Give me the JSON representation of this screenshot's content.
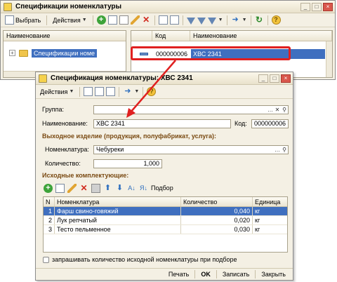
{
  "back_window": {
    "title": "Спецификации номенклатуры",
    "toolbar": {
      "select_label": "Выбрать",
      "actions_label": "Действия"
    },
    "left_pane": {
      "header": "Наименование",
      "tree_item": "Спецификации номе"
    },
    "right_pane": {
      "headers": {
        "code": "Код",
        "name": "Наименование"
      },
      "row": {
        "code": "000000006",
        "name": "ХВС 2341"
      }
    }
  },
  "front_window": {
    "title": "Спецификация номенклатуры: ХВС 2341",
    "toolbar": {
      "actions_label": "Действия"
    },
    "group_label": "Группа:",
    "group_value": "",
    "name_label": "Наименование:",
    "name_value": "ХВС 2341",
    "code_label": "Код:",
    "code_value": "000000006",
    "output_section": "Выходное изделие (продукция, полуфабрикат, услуга):",
    "nomenclature_label": "Номенклатура:",
    "nomenclature_value": "Чебуреки",
    "quantity_label": "Количество:",
    "quantity_value": "1,000",
    "components_section": "Исходные комплектующие:",
    "selection_label": "Подбор",
    "table": {
      "headers": [
        "N",
        "Номенклатура",
        "Количество",
        "Единица"
      ],
      "rows": [
        {
          "n": "1",
          "nom": "Фарш свино-говяжий",
          "qty": "0,040",
          "unit": "кг"
        },
        {
          "n": "2",
          "nom": "Лук репчатый",
          "qty": "0,020",
          "unit": "кг"
        },
        {
          "n": "3",
          "nom": "Тесто пельменное",
          "qty": "0,030",
          "unit": "кг"
        }
      ]
    },
    "checkbox_label": "запрашивать количество исходной номенклатуры при подборе",
    "footer": {
      "print": "Печать",
      "ok": "OK",
      "save": "Записать",
      "close": "Закрыть"
    }
  },
  "colors": {
    "selection": "#3f6fbf",
    "highlight": "#e02020",
    "section_title": "#7a4a12"
  }
}
